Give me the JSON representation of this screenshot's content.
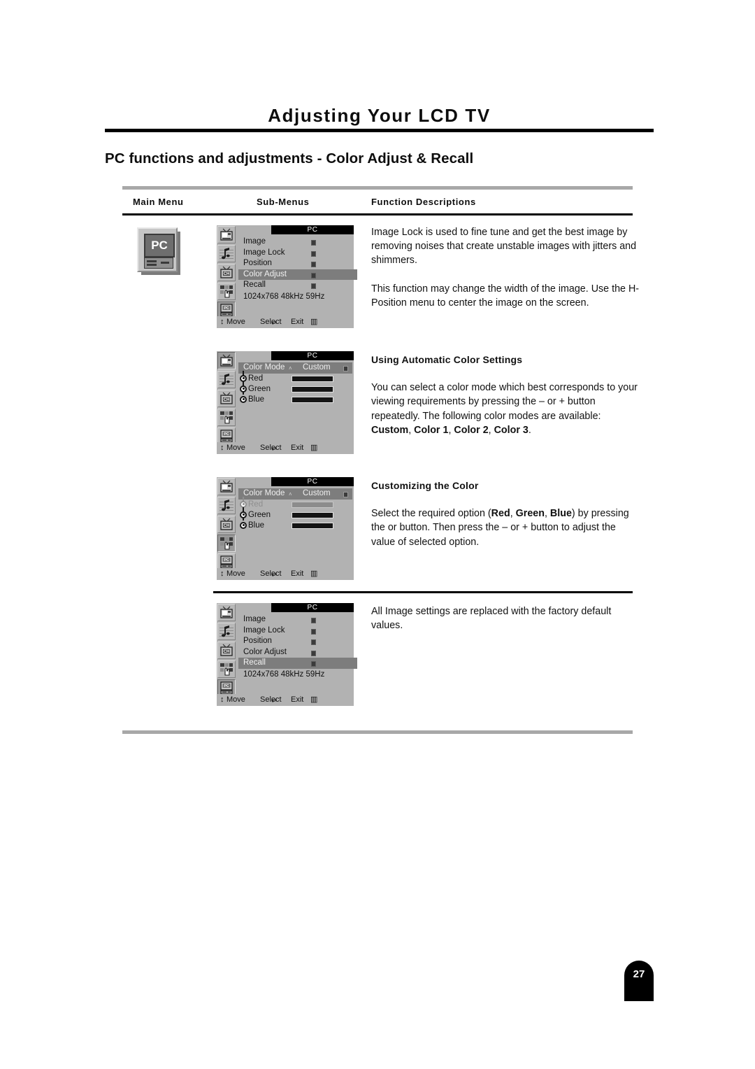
{
  "page": {
    "title": "Adjusting Your LCD TV",
    "section_title": "PC functions and adjustments - Color Adjust & Recall",
    "number": "27"
  },
  "table_headers": {
    "main_menu": "Main Menu",
    "sub_menus": "Sub-Menus",
    "function_descriptions": "Function Descriptions"
  },
  "main_menu_icon": {
    "label": "PC",
    "name": "pc-monitor-icon"
  },
  "osd_footer": {
    "updown": "↕",
    "move": "Move",
    "select": "Select",
    "enter": "↵",
    "exit": "Exit",
    "menu_glyph": "▥"
  },
  "osd_rail_icons": [
    {
      "name": "picture-icon",
      "label": "Picture"
    },
    {
      "name": "sound-icon",
      "label": "Sound"
    },
    {
      "name": "channel-icon",
      "label": "CH"
    },
    {
      "name": "setup-hand-icon",
      "label": "Setup"
    },
    {
      "name": "pc-icon",
      "label": "PC"
    }
  ],
  "panels": [
    {
      "id": "panel-color-adjust",
      "titlebar": "PC",
      "type": "list",
      "rows": [
        {
          "label": "Image",
          "highlight": false
        },
        {
          "label": "Image Lock",
          "highlight": false
        },
        {
          "label": "Position",
          "highlight": false
        },
        {
          "label": "Color Adjust",
          "highlight": true
        },
        {
          "label": "Recall",
          "highlight": false
        }
      ],
      "info": "1024x768   48kHz  59Hz",
      "selected_rail": 4
    },
    {
      "id": "panel-color-mode",
      "titlebar": "PC",
      "type": "colormode",
      "head_label": "Color Mode",
      "head_value": "Custom",
      "rows": [
        {
          "label": "Red",
          "dim": false
        },
        {
          "label": "Green",
          "dim": false
        },
        {
          "label": "Blue",
          "dim": false
        }
      ],
      "selected_rail": 0
    },
    {
      "id": "panel-color-mode-red",
      "titlebar": "PC",
      "type": "colormode",
      "head_label": "Color Mode",
      "head_value": "Custom",
      "rows": [
        {
          "label": "Red",
          "dim": true
        },
        {
          "label": "Green",
          "dim": false
        },
        {
          "label": "Blue",
          "dim": false
        }
      ],
      "selected_rail": 3
    },
    {
      "id": "panel-recall",
      "titlebar": "PC",
      "type": "list",
      "rows": [
        {
          "label": "Image",
          "highlight": false
        },
        {
          "label": "Image Lock",
          "highlight": false
        },
        {
          "label": "Position",
          "highlight": false
        },
        {
          "label": "Color Adjust",
          "highlight": false
        },
        {
          "label": "Recall",
          "highlight": true
        }
      ],
      "info": "1024x768   48kHz  59Hz",
      "selected_rail": 4
    }
  ],
  "descriptions": {
    "d1_p1": "Image Lock is used to fine tune and get the best image by removing noises that create unstable images with jitters and shimmers.",
    "d1_p2": "This function may change the width of the image. Use the H-Position menu to center the image on the screen.",
    "d2_heading": "Using Automatic Color Settings",
    "d2_p1_a": "You can select a color mode which best corresponds to your viewing requirements by pressing the – or + button repeatedly. The following color modes are available: ",
    "d2_b1": "Custom",
    "d2_sep1": ", ",
    "d2_b2": "Color 1",
    "d2_sep2": ", ",
    "d2_b3": "Color 2",
    "d2_sep3": ", ",
    "d2_b4": "Color 3",
    "d2_end": ".",
    "d3_heading": "Customizing the Color",
    "d3_a": "Select the required option (",
    "d3_b1": "Red",
    "d3_sep1": ", ",
    "d3_b2": "Green",
    "d3_sep2": ", ",
    "d3_b3": "Blue",
    "d3_b": ") by pressing the    or    button. Then press the – or + button to adjust the value of selected option.",
    "d4_p1": "All Image settings are replaced with the factory default values."
  }
}
